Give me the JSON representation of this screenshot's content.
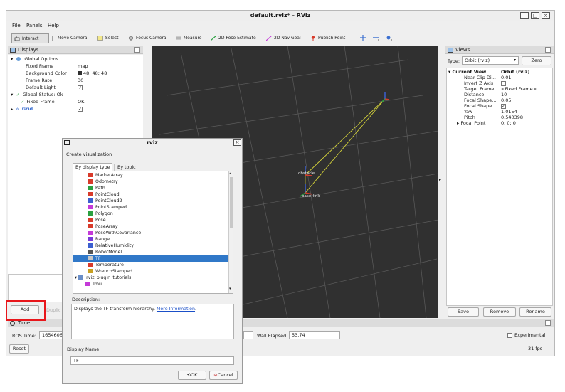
{
  "window": {
    "title": "default.rviz* - RViz"
  },
  "menu": [
    "File",
    "Panels",
    "Help"
  ],
  "toolbar": {
    "tools": [
      "Interact",
      "Move Camera",
      "Select",
      "Focus Camera",
      "Measure",
      "2D Pose Estimate",
      "2D Nav Goal",
      "Publish Point"
    ],
    "icons": [
      "crosshair-icon",
      "minus-icon",
      "camera-icon"
    ]
  },
  "displays": {
    "title": "Displays",
    "rows": [
      {
        "label": "Global Options",
        "value": ""
      },
      {
        "label": "Fixed Frame",
        "value": "map"
      },
      {
        "label": "Background Color",
        "value": "48; 48; 48"
      },
      {
        "label": "Frame Rate",
        "value": "30"
      },
      {
        "label": "Default Light",
        "value": "✓"
      },
      {
        "label": "Global Status: Ok",
        "value": ""
      },
      {
        "label": "Fixed Frame",
        "value": "OK"
      },
      {
        "label": "Grid",
        "value": "✓"
      }
    ],
    "add_label": "Add",
    "duplicate_label": "Duplic"
  },
  "viewport": {
    "labels": [
      "obstacle",
      "base_link"
    ]
  },
  "views": {
    "title": "Views",
    "type_label": "Type:",
    "type_value": "Orbit (rviz)",
    "zero_label": "Zero",
    "header_left": "Current View",
    "header_right": "Orbit (rviz)",
    "rows": [
      {
        "label": "Near Clip Di...",
        "value": "0.01"
      },
      {
        "label": "Invert Z Axis",
        "value": ""
      },
      {
        "label": "Target Frame",
        "value": "<Fixed Frame>"
      },
      {
        "label": "Distance",
        "value": "10"
      },
      {
        "label": "Focal Shape...",
        "value": "0.05"
      },
      {
        "label": "Focal Shape...",
        "value": "✓"
      },
      {
        "label": "Yaw",
        "value": "1.0154"
      },
      {
        "label": "Pitch",
        "value": "0.540398"
      },
      {
        "label": "Focal Point",
        "value": "0; 0; 0"
      }
    ],
    "save_label": "Save",
    "remove_label": "Remove",
    "rename_label": "Rename"
  },
  "time": {
    "title": "Time",
    "ros_time_label": "ROS Time:",
    "ros_time_value": "1654606",
    "wall_elapsed_label": "Wall Elapsed:",
    "wall_elapsed_value": "53.74",
    "experimental_label": "Experimental",
    "reset_label": "Reset",
    "fps": "31 fps"
  },
  "dialog": {
    "title": "rviz",
    "subtitle": "Create visualization",
    "tab_display_type": "By display type",
    "tab_topic": "By topic",
    "items": [
      {
        "label": "MarkerArray",
        "color": "#d83a2a"
      },
      {
        "label": "Odometry",
        "color": "#d83a2a"
      },
      {
        "label": "Path",
        "color": "#2aa040"
      },
      {
        "label": "PointCloud",
        "color": "#d83a2a"
      },
      {
        "label": "PointCloud2",
        "color": "#3b5fd0"
      },
      {
        "label": "PointStamped",
        "color": "#c43ad8"
      },
      {
        "label": "Polygon",
        "color": "#2aa040"
      },
      {
        "label": "Pose",
        "color": "#d83a2a"
      },
      {
        "label": "PoseArray",
        "color": "#d83a2a"
      },
      {
        "label": "PoseWithCovariance",
        "color": "#c43ad8"
      },
      {
        "label": "Range",
        "color": "#7a3ad8"
      },
      {
        "label": "RelativeHumidity",
        "color": "#3b5fd0"
      },
      {
        "label": "RobotModel",
        "color": "#555555"
      },
      {
        "label": "TF",
        "color": "#c8c8c8"
      },
      {
        "label": "Temperature",
        "color": "#d83a2a"
      },
      {
        "label": "WrenchStamped",
        "color": "#c8a020"
      },
      {
        "label": "rviz_plugin_tutorials",
        "color": "#6a8ec8"
      },
      {
        "label": "Imu",
        "color": "#c43ad8"
      }
    ],
    "selected_index": 13,
    "description_label": "Description:",
    "description_text": "Displays the TF transform hierarchy. ",
    "description_link": "More Information",
    "description_end": ".",
    "display_name_label": "Display Name",
    "display_name_value": "TF",
    "ok_label": "OK",
    "cancel_label": "Cancel"
  },
  "colors": {
    "accent": "#3078c8",
    "highlight": "#e8161b",
    "viewport_bg": "#303030"
  }
}
